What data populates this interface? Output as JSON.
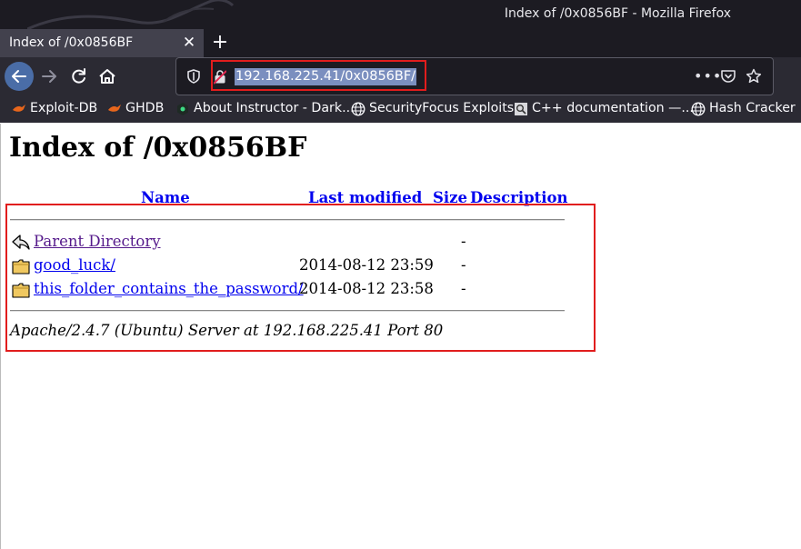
{
  "window": {
    "title": "Index of /0x0856BF - Mozilla Firefox"
  },
  "tab": {
    "title": "Index of /0x0856BF",
    "close_glyph": "✕",
    "new_tab_glyph": "+"
  },
  "urlbar": {
    "url": "192.168.225.41/0x0856BF/",
    "more_glyph": "•••"
  },
  "bookmarks": [
    {
      "label": "Exploit-DB",
      "icon": "exploit-db-icon"
    },
    {
      "label": "GHDB",
      "icon": "ghdb-icon"
    },
    {
      "label": "About Instructor - Dark...",
      "icon": "instructor-icon"
    },
    {
      "label": "SecurityFocus Exploits",
      "icon": "globe-icon"
    },
    {
      "label": "C++ documentation —...",
      "icon": "search-doc-icon"
    },
    {
      "label": "Hash Cracker",
      "icon": "globe-icon"
    }
  ],
  "page": {
    "heading": "Index of /0x0856BF",
    "columns": {
      "name": "Name",
      "last_modified": "Last modified",
      "size": "Size",
      "description": "Description"
    },
    "rows": [
      {
        "name": "Parent Directory",
        "date": "",
        "size": "-",
        "icon": "back-arrow-icon"
      },
      {
        "name": "good_luck/",
        "date": "2014-08-12 23:59",
        "size": "-",
        "icon": "folder-icon"
      },
      {
        "name": "this_folder_contains_the_password/",
        "date": "2014-08-12 23:58",
        "size": "-",
        "icon": "folder-icon"
      }
    ],
    "address": "Apache/2.4.7 (Ubuntu) Server at 192.168.225.41 Port 80"
  },
  "colors": {
    "link": "#0000ee",
    "visited": "#551a8b",
    "highlight_box": "#e11d1d",
    "chrome_dark": "#1c1b22",
    "toolbar": "#2b2a33"
  }
}
